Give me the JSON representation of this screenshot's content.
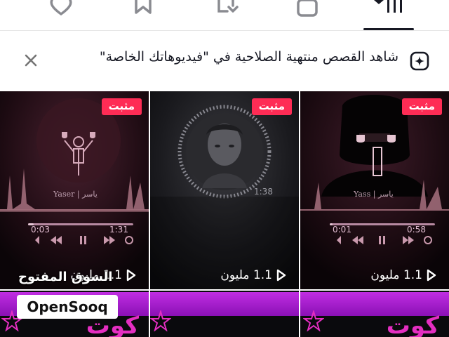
{
  "tabs": [
    {
      "id": "liked",
      "icon": "heart-icon"
    },
    {
      "id": "saved",
      "icon": "bookmark-icon"
    },
    {
      "id": "reposts",
      "icon": "repost-icon"
    },
    {
      "id": "private",
      "icon": "lock-icon"
    },
    {
      "id": "videos",
      "icon": "grid-icon",
      "active": true
    }
  ],
  "notice": {
    "icon": "sparkle-icon",
    "text": "شاهد القصص منتهية الصلاحية في \"فيديوهاتك الخاصة\"",
    "close_icon": "close-icon"
  },
  "videos": [
    {
      "badge": "مثبت",
      "views": "1.1 مليون",
      "player": {
        "name": "Yaser | ياسر",
        "elapsed": "0:03",
        "duration": "1:31"
      }
    },
    {
      "badge": "مثبت",
      "views": "1.1 مليون",
      "player": {
        "elapsed": "1:38"
      }
    },
    {
      "badge": "مثبت",
      "views": "1.1 مليون",
      "player": {
        "name": "Yass | ياسر",
        "elapsed": "0:01",
        "duration": "0:58"
      }
    },
    {
      "text": "كوت"
    },
    {
      "text": ""
    },
    {
      "text": "كوت"
    }
  ],
  "watermark": {
    "arabic": "السوق المفتوح",
    "latin": "OpenSooq"
  },
  "colors": {
    "pin_badge": "#fe2c55",
    "text_primary": "#161823",
    "purple": "#c12ee3"
  }
}
